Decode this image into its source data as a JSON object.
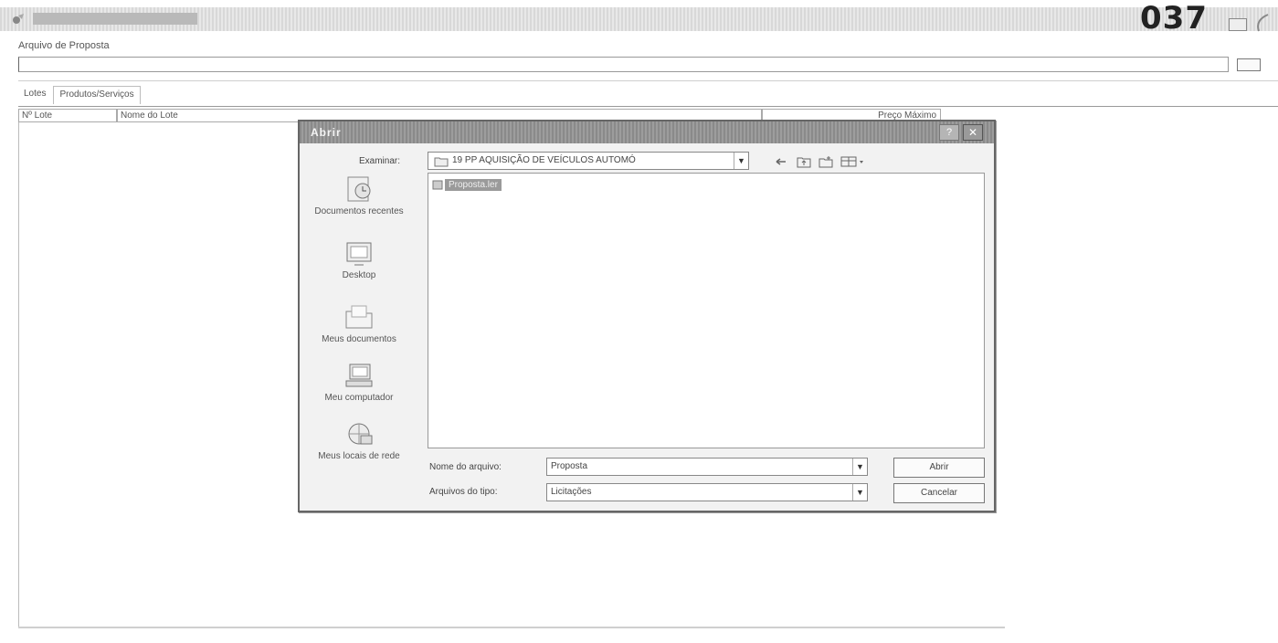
{
  "window": {
    "title": "",
    "stamp": "037"
  },
  "form": {
    "proposal_file_label": "Arquivo de Proposta",
    "proposal_file_value": ""
  },
  "tabs": [
    {
      "label": "Lotes"
    },
    {
      "label": "Produtos/Serviços"
    }
  ],
  "grid": {
    "columns": [
      "Nº Lote",
      "Nome do Lote",
      "Preço Máximo"
    ]
  },
  "dialog": {
    "title": "Abrir",
    "help_label": "?",
    "close_label": "✕",
    "look_in_label": "Examinar:",
    "look_in_value": "19 PP AQUISIÇÃO DE VEÍCULOS AUTOMÓ",
    "places": [
      {
        "label": "Documentos recentes",
        "icon": "recent-documents-icon"
      },
      {
        "label": "Desktop",
        "icon": "desktop-icon"
      },
      {
        "label": "Meus documentos",
        "icon": "my-documents-icon"
      },
      {
        "label": "Meu computador",
        "icon": "my-computer-icon"
      },
      {
        "label": "Meus locais de rede",
        "icon": "network-places-icon"
      }
    ],
    "files": [
      {
        "name": "Proposta.ler",
        "selected": true
      }
    ],
    "file_name_label": "Nome do arquivo:",
    "file_name_value": "Proposta",
    "file_type_label": "Arquivos do tipo:",
    "file_type_value": "Licitações",
    "open_button": "Abrir",
    "cancel_button": "Cancelar"
  },
  "colors": {
    "titlebar": "#9d9d9d",
    "selection": "#9a9a9a",
    "background": "#ffffff"
  }
}
